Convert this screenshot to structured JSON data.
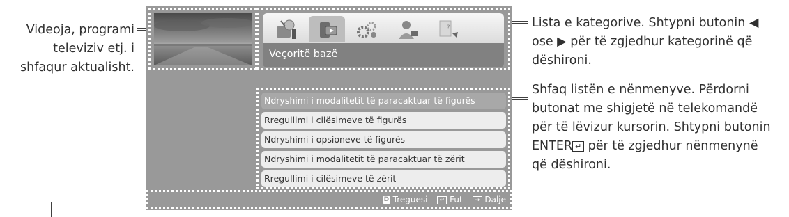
{
  "callouts": {
    "video": [
      "Videoja, programi",
      "televiziv etj. i",
      "shfaqur aktualisht."
    ],
    "categories": {
      "line1_before": "Lista e kategorive. Shtypni butonin ",
      "arrow_left": "◀",
      "line2_before": "ose ",
      "arrow_right": "▶",
      "line2_after": " për të zgjedhur kategorinë që",
      "line3": "dëshironi."
    },
    "submenu": {
      "line1": "Shfaq listën e nënmenyve. Përdorni",
      "line2": "butonat me shigjetë në telekomandë",
      "line3": "për të lëvizur kursorin. Shtypni butonin",
      "line4_key": "ENTER",
      "line4_after": " për të zgjedhur nënmenynë",
      "line5": "që dëshironi."
    }
  },
  "screen": {
    "category_icons": [
      "satellite-tools-icon",
      "media-tv-icon",
      "gears-icon",
      "support-person-icon",
      "help-icon"
    ],
    "selected_category_index": 1,
    "category_label": "Veçoritë bazë",
    "menu_items": [
      "Ndryshimi i modalitetit të paracaktuar të figurës",
      "Rregullimi i cilësimeve të figurës",
      "Ndryshimi i opsioneve të figurës",
      "Ndryshimi i modalitetit të paracaktuar të zërit",
      "Rregullimi i cilësimeve të zërit"
    ],
    "active_menu_index": 0,
    "bottom_bar": {
      "guide_key": "D",
      "guide_label": "Treguesi",
      "enter_label": "Fut",
      "exit_label": "Dalje"
    }
  },
  "colors": {
    "screen_bg": "#999999",
    "dotted_outline": "#ffffff",
    "menu_item_bg": "#ededed",
    "menu_item_active_bg": "#a8a8a8",
    "callout_text": "#303030"
  }
}
